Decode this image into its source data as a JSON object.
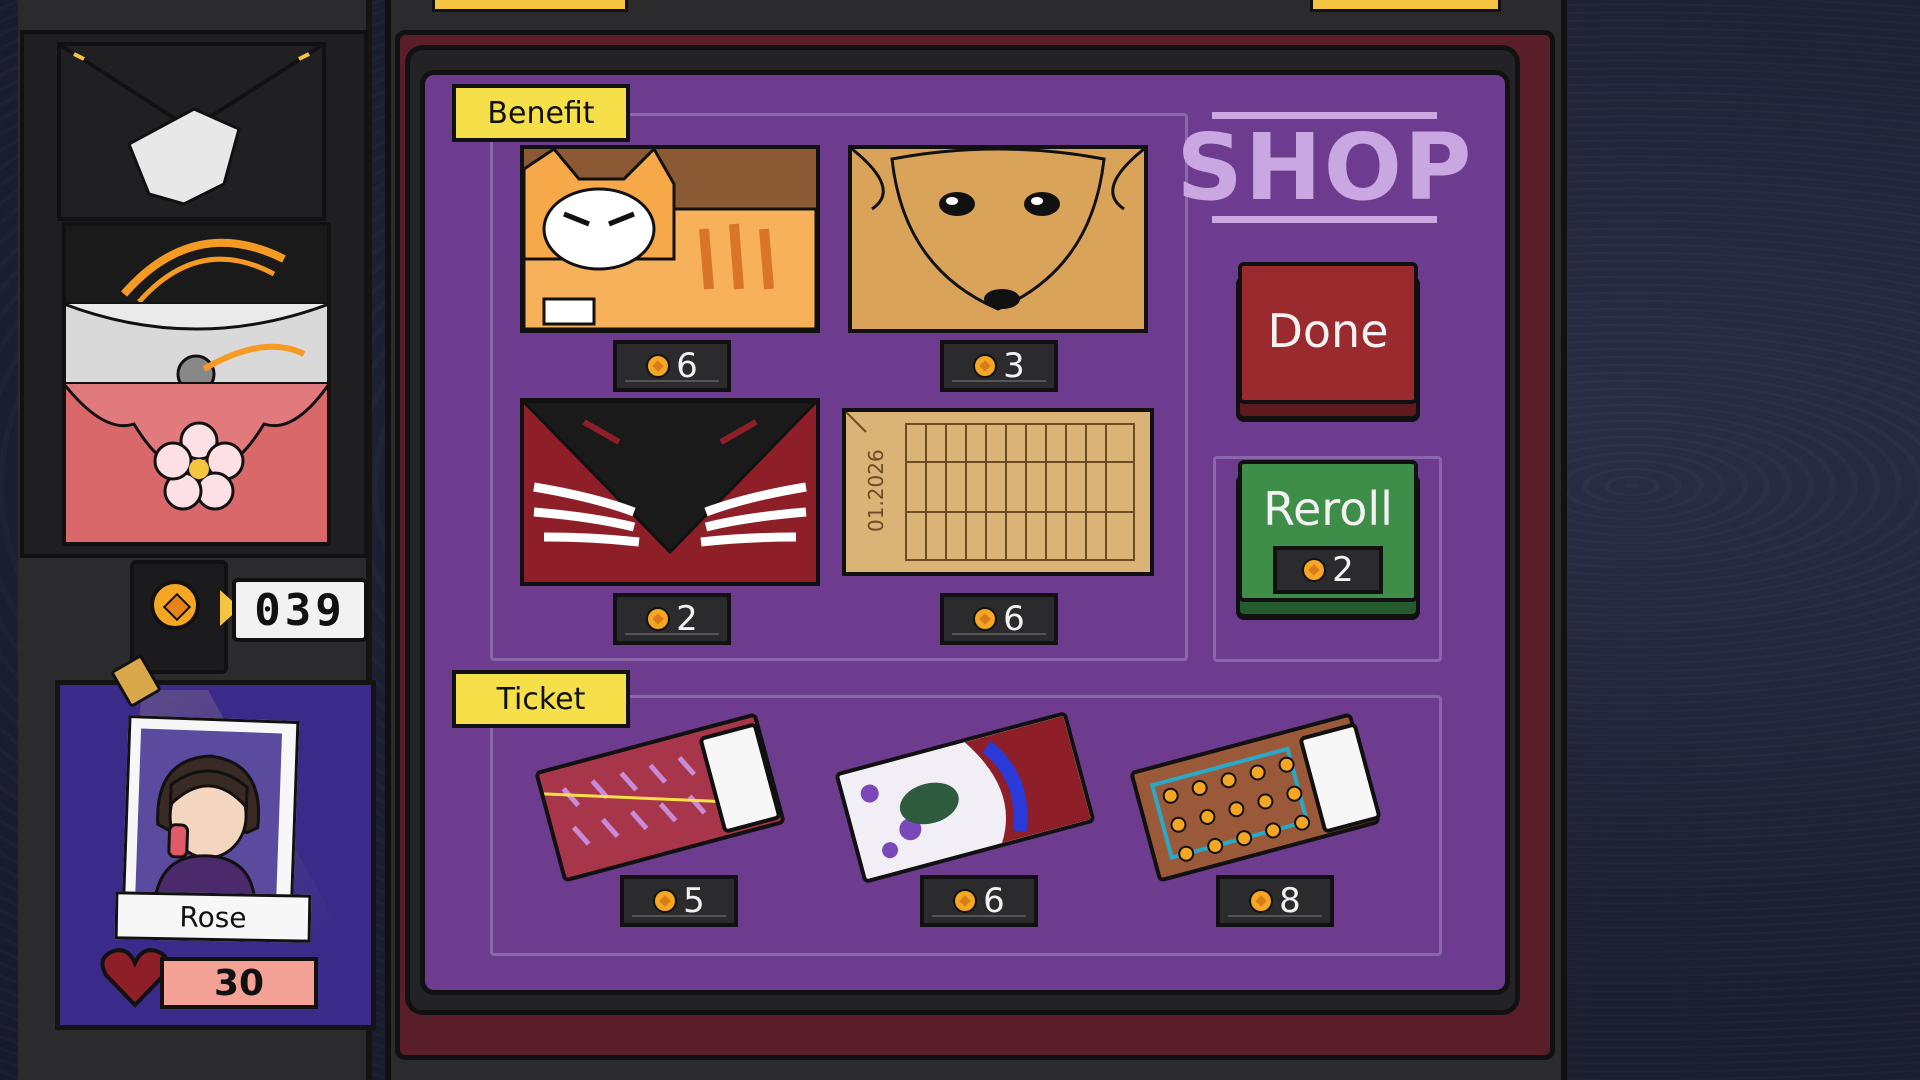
{
  "player": {
    "coins": "039",
    "name": "Rose",
    "health": "30"
  },
  "shop": {
    "title": "SHOP",
    "benefit_label": "Benefit",
    "ticket_label": "Ticket",
    "benefits": [
      {
        "name": "cat-envelope",
        "price": "6"
      },
      {
        "name": "dog-envelope",
        "price": "3"
      },
      {
        "name": "fox-envelope",
        "price": "2"
      },
      {
        "name": "calendar-envelope",
        "price": "6",
        "date_text": "01.2026"
      }
    ],
    "tickets": [
      {
        "name": "scissors-ticket",
        "price": "5"
      },
      {
        "name": "paint-ticket",
        "price": "6"
      },
      {
        "name": "coin-ticket",
        "price": "8"
      }
    ],
    "done_label": "Done",
    "reroll_label": "Reroll",
    "reroll_price": "2"
  },
  "colors": {
    "board_purple": "#6d3c8e",
    "label_yellow": "#f5e04a",
    "coin_orange": "#f5a623",
    "done_red": "#9a2a2e",
    "reroll_green": "#3e8e4a"
  }
}
